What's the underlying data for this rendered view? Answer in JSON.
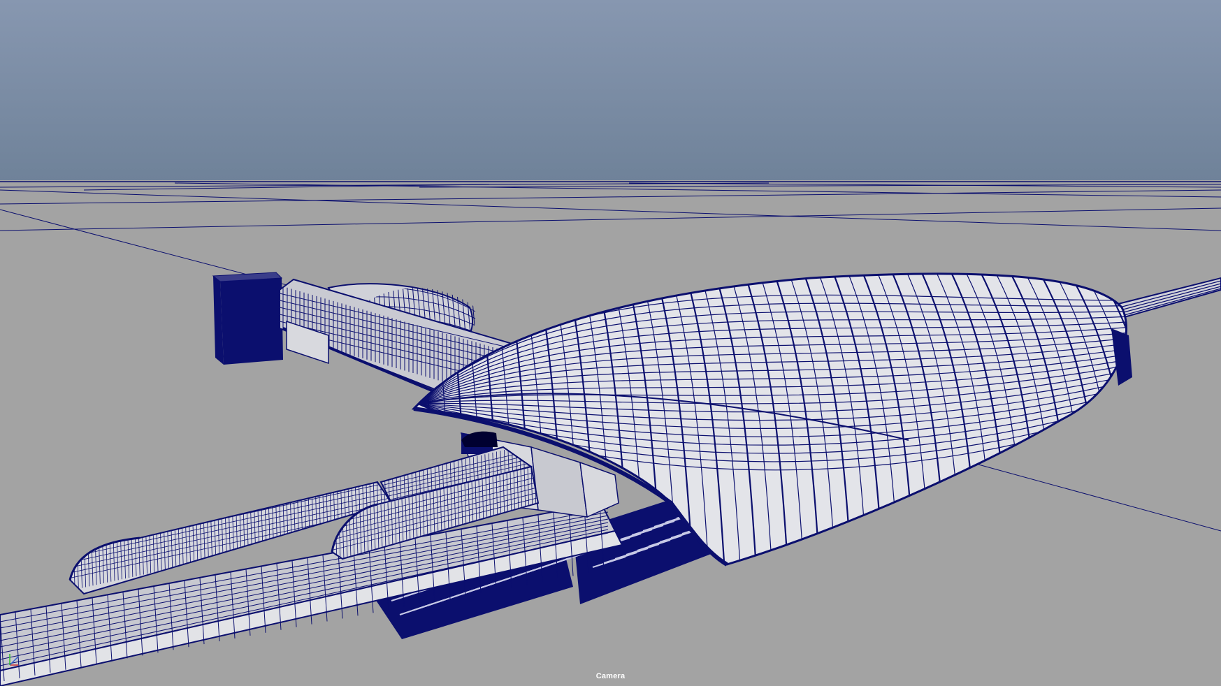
{
  "viewport": {
    "camera_label": "Camera",
    "colors": {
      "sky_top": "#8797b0",
      "sky_bottom": "#6f8299",
      "ground": "#a3a3a3",
      "wire": "#0b0f6e",
      "shaded": "#d8d9de"
    },
    "icons": {
      "axis_gizmo": "xyz-axis-icon"
    }
  }
}
